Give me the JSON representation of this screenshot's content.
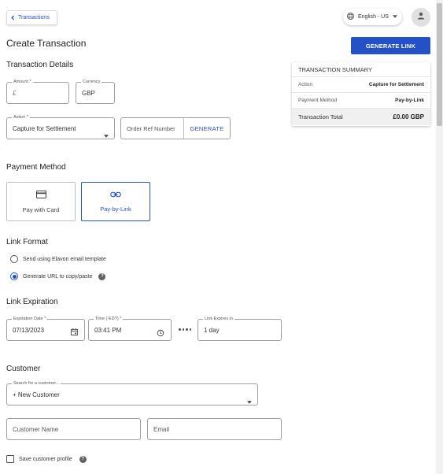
{
  "header": {
    "back_label": "Transactions",
    "language": "English - US"
  },
  "page": {
    "title": "Create Transaction",
    "generate_link_label": "GENERATE LINK"
  },
  "details": {
    "heading": "Transaction Details",
    "amount_label": "Amount *",
    "amount_prefix": "£",
    "currency_label": "Currency",
    "currency_value": "GBP",
    "action_label": "Action *",
    "action_value": "Capture for Settlement",
    "order_ref_placeholder": "Order Ref Number",
    "generate_label": "GENERATE"
  },
  "summary": {
    "title": "TRANSACTION SUMMARY",
    "action_label": "Action",
    "action_value": "Capture for Settlement",
    "method_label": "Payment Method",
    "method_value": "Pay-by-Link",
    "total_label": "Transaction Total",
    "total_value": "£0.00 GBP"
  },
  "payment_method": {
    "heading": "Payment Method",
    "options": [
      "Pay with Card",
      "Pay-by-Link"
    ],
    "selected": "Pay-by-Link"
  },
  "link_format": {
    "heading": "Link Format",
    "options": [
      "Send using Elavon email template",
      "Generate URL to copy/paste"
    ],
    "selected": "Generate URL to copy/paste"
  },
  "link_expiration": {
    "heading": "Link Expiration",
    "date_label": "Expiration Date *",
    "date_value": "07/13/2023",
    "time_label": "Time ( EDT) *",
    "time_value": "03:41 PM",
    "expires_label": "Link Expires in",
    "expires_value": "1 day"
  },
  "customer": {
    "heading": "Customer",
    "search_label": "Search for a customer...",
    "search_value": "+ New Customer",
    "name_placeholder": "Customer Name",
    "email_placeholder": "Email",
    "save_profile_label": "Save customer profile"
  },
  "colors": {
    "accent": "#2451c8"
  }
}
